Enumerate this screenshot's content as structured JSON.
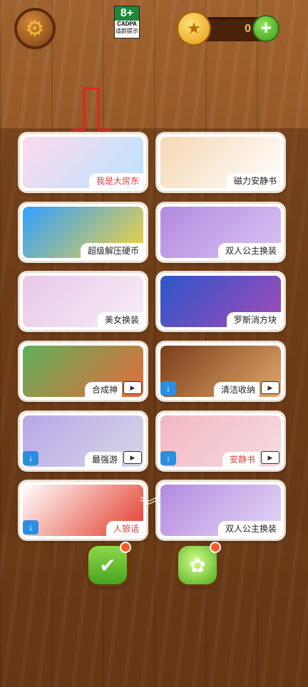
{
  "header": {
    "settings_icon": "gear-icon",
    "age_rating": "8+",
    "age_org": "CADPA",
    "age_caption": "适龄提示",
    "coins": "0",
    "coin_icon": "star-coin-icon",
    "add_coins": "+"
  },
  "games": [
    {
      "label": "我是大房东",
      "label_color": "#e83a3a",
      "download": false,
      "play": false,
      "thumb": [
        "#ffd9ec",
        "#b8e4ff"
      ]
    },
    {
      "label": "磁力安静书",
      "label_color": "#222222",
      "download": false,
      "play": false,
      "thumb": [
        "#f6d7b3",
        "#ffffff"
      ]
    },
    {
      "label": "超级解压硬币",
      "label_color": "#222222",
      "download": false,
      "play": false,
      "thumb": [
        "#2fa0ff",
        "#f4d240"
      ]
    },
    {
      "label": "双人公主换装",
      "label_color": "#222222",
      "download": false,
      "play": false,
      "thumb": [
        "#b48ae0",
        "#d9c3f2"
      ]
    },
    {
      "label": "美女换装",
      "label_color": "#222222",
      "download": false,
      "play": false,
      "thumb": [
        "#e9c7e8",
        "#f7eef7"
      ]
    },
    {
      "label": "罗斯消方块",
      "label_color": "#222222",
      "download": false,
      "play": false,
      "thumb": [
        "#2c57c9",
        "#a44ab8"
      ]
    },
    {
      "label": "合成神",
      "label_color": "#222222",
      "download": false,
      "play": true,
      "thumb": [
        "#5fb05a",
        "#e66a3a"
      ]
    },
    {
      "label": "清洁收纳",
      "label_color": "#222222",
      "download": true,
      "play": true,
      "thumb": [
        "#7a3d1a",
        "#e0a86a"
      ]
    },
    {
      "label": "最强游",
      "label_color": "#222222",
      "download": true,
      "play": true,
      "thumb": [
        "#b7a7e8",
        "#d9d6e6"
      ]
    },
    {
      "label": "安静书",
      "label_color": "#e83a3a",
      "download": true,
      "play": true,
      "thumb": [
        "#f2b7c3",
        "#f6dcdf"
      ]
    },
    {
      "label": "人狼话",
      "label_color": "#e83a3a",
      "download": true,
      "play": false,
      "thumb": [
        "#ffffff",
        "#e23a2a"
      ]
    },
    {
      "label": "双人公主换装",
      "label_color": "#222222",
      "download": false,
      "play": false,
      "thumb": [
        "#b48ae0",
        "#e4d7f6"
      ]
    }
  ],
  "icons": {
    "download": "↓",
    "play": "▶",
    "scroll_more": "︾"
  },
  "bottom_bar": {
    "left_icon": "checklist-icon",
    "left_glyph": "✔",
    "right_icon": "lime-icon",
    "right_glyph": "✿"
  }
}
